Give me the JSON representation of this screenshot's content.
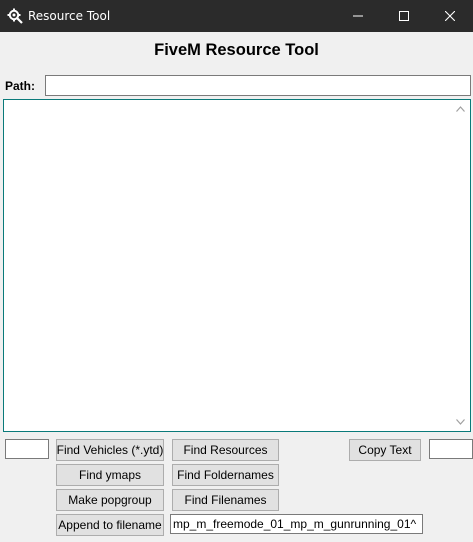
{
  "window": {
    "title": "Resource Tool",
    "icon": "gear-wrench-icon",
    "controls": [
      "minimize-icon",
      "maximize-icon",
      "close-icon"
    ]
  },
  "heading": "FiveM Resource Tool",
  "path": {
    "label": "Path:",
    "value": ""
  },
  "output": {
    "text": ""
  },
  "buttons": {
    "find_vehicles": "Find Vehicles (*.ytd)",
    "find_resources": "Find Resources",
    "copy_text": "Copy Text",
    "find_ymaps": "Find ymaps",
    "find_foldernames": "Find Foldernames",
    "make_popgroup": "Make popgroup",
    "find_filenames": "Find Filenames",
    "append_to_filename": "Append to filename"
  },
  "inputs": {
    "left_box": "",
    "right_box": "",
    "append_value": "mp_m_freemode_01_mp_m_gunrunning_01^"
  },
  "colors": {
    "titlebar": "#2b2b2b",
    "background": "#f0f0f0",
    "output_border": "#0a7a7a"
  }
}
